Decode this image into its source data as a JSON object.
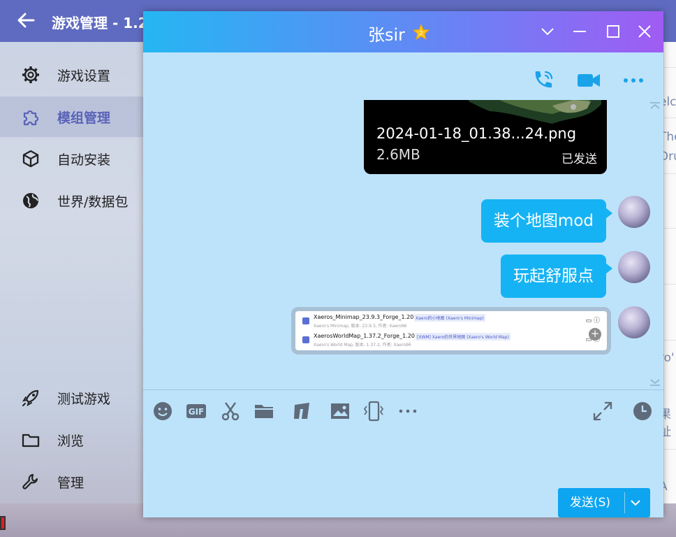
{
  "launcher": {
    "title": "游戏管理 - 1.2",
    "sidebar_items": [
      {
        "label": "游戏设置",
        "icon": "gear-icon"
      },
      {
        "label": "模组管理",
        "icon": "puzzle-icon",
        "active": true
      },
      {
        "label": "自动安装",
        "icon": "cube-icon"
      },
      {
        "label": "世界/数据包",
        "icon": "globe-icon"
      },
      {
        "label": "测试游戏",
        "icon": "rocket-icon"
      },
      {
        "label": "浏览",
        "icon": "folder-icon"
      },
      {
        "label": "管理",
        "icon": "wrench-icon"
      }
    ],
    "strip_texts": [
      "elc",
      "The",
      "Dru",
      "ro'",
      "果址",
      "A"
    ]
  },
  "chat": {
    "contact_name": "张sir",
    "file_message": {
      "name": "2024-01-18_01.38...24.png",
      "size": "2.6MB",
      "status": "已发送"
    },
    "text_messages": [
      "装个地图mod",
      "玩起舒服点"
    ],
    "image_message": {
      "mods": [
        {
          "name": "Xaeros_Minimap_23.9.3_Forge_1.20",
          "tag": "Xaero的小地图 (Xaero's Minimap)",
          "sub": "Xaero's Minimap, 版本: 23.9.3, 作者: Xaero96"
        },
        {
          "name": "XaerosWorldMap_1.37.2_Forge_1.20",
          "tag": "[XWM] Xaero的世界地图 (Xaero's World Map)",
          "sub": "Xaero's World Map, 版本: 1.37.2, 作者: Xaero96"
        }
      ]
    },
    "send_label": "发送(S)",
    "colors": {
      "window_bg": "#bde3fb",
      "bubble": "#16b3f4",
      "title_gradient_start": "#25b6f3",
      "title_gradient_end": "#a05cf3",
      "icon_accent": "#1aa3e8",
      "send_button": "#0ea5f0"
    }
  }
}
